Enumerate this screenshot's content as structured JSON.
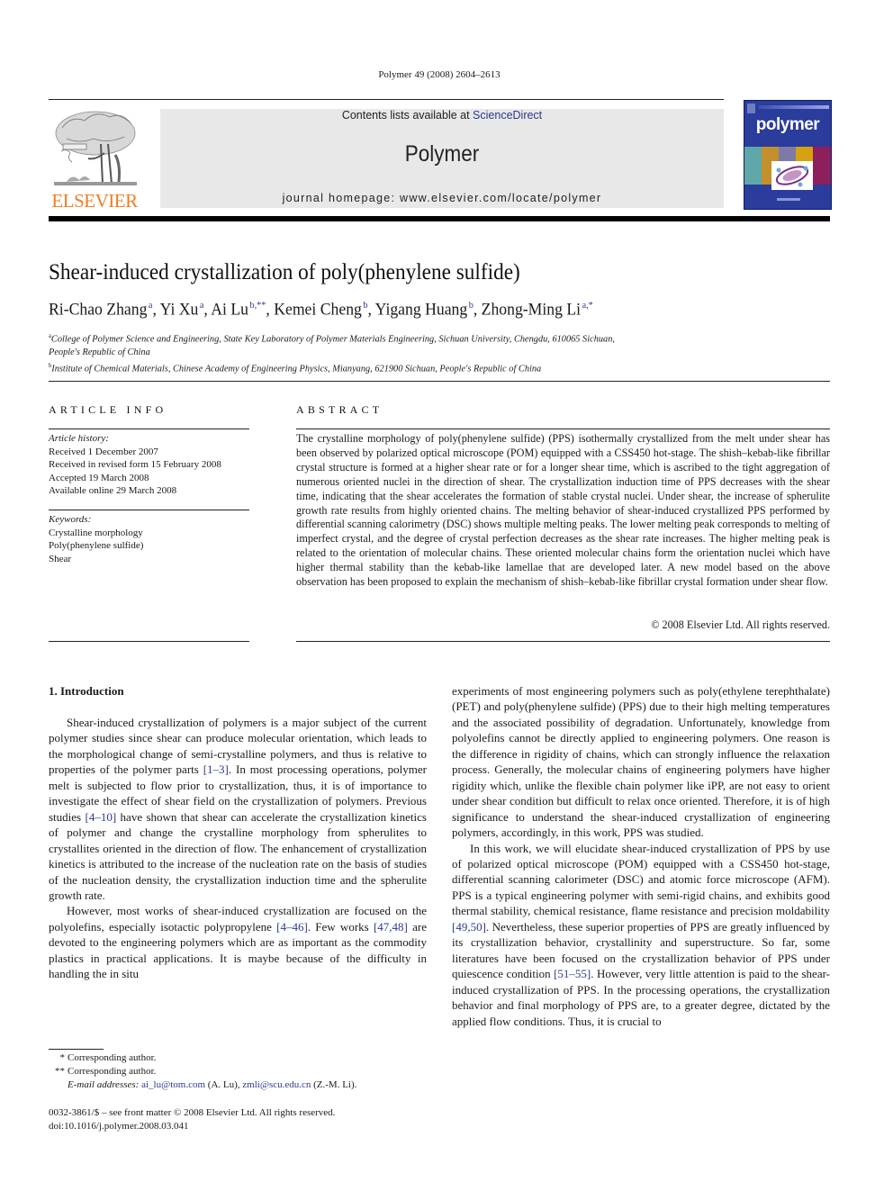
{
  "citation": "Polymer 49 (2008) 2604–2613",
  "header": {
    "publisher_logo_text": "ELSEVIER",
    "contents_prefix": "Contents lists available at ",
    "contents_link": "ScienceDirect",
    "journal_name": "Polymer",
    "homepage": "journal homepage: www.elsevier.com/locate/polymer",
    "cover_title": "polymer",
    "colors": {
      "elsevier_orange": "#f07d22",
      "cover_blue": "#2a3c9c",
      "link_blue": "#2b3a8f"
    }
  },
  "article": {
    "title": "Shear-induced crystallization of poly(phenylene sulfide)",
    "authors": [
      {
        "name": "Ri-Chao Zhang",
        "sup": "a",
        "sep": ", "
      },
      {
        "name": "Yi Xu",
        "sup": "a",
        "sep": ", "
      },
      {
        "name": "Ai Lu",
        "sup": "b,**",
        "sep": ", "
      },
      {
        "name": "Kemei Cheng",
        "sup": "b",
        "sep": ", "
      },
      {
        "name": "Yigang Huang",
        "sup": "b",
        "sep": ", "
      },
      {
        "name": "Zhong-Ming Li",
        "sup": "a,*",
        "sep": ""
      }
    ],
    "affiliations": [
      {
        "mark": "a",
        "text": "College of Polymer Science and Engineering, State Key Laboratory of Polymer Materials Engineering, Sichuan University, Chengdu, 610065 Sichuan, People's Republic of China"
      },
      {
        "mark": "b",
        "text": "Institute of Chemical Materials, Chinese Academy of Engineering Physics, Mianyang, 621900 Sichuan, People's Republic of China"
      }
    ]
  },
  "article_info": {
    "heading": "ARTICLE INFO",
    "history_label": "Article history:",
    "history": [
      "Received 1 December 2007",
      "Received in revised form 15 February 2008",
      "Accepted 19 March 2008",
      "Available online 29 March 2008"
    ],
    "keywords_label": "Keywords:",
    "keywords": [
      "Crystalline morphology",
      "Poly(phenylene sulfide)",
      "Shear"
    ]
  },
  "abstract": {
    "heading": "ABSTRACT",
    "text": "The crystalline morphology of poly(phenylene sulfide) (PPS) isothermally crystallized from the melt under shear has been observed by polarized optical microscope (POM) equipped with a CSS450 hot-stage. The shish–kebab-like fibrillar crystal structure is formed at a higher shear rate or for a longer shear time, which is ascribed to the tight aggregation of numerous oriented nuclei in the direction of shear. The crystallization induction time of PPS decreases with the shear time, indicating that the shear accelerates the formation of stable crystal nuclei. Under shear, the increase of spherulite growth rate results from highly oriented chains. The melting behavior of shear-induced crystallized PPS performed by differential scanning calorimetry (DSC) shows multiple melting peaks. The lower melting peak corresponds to melting of imperfect crystal, and the degree of crystal perfection decreases as the shear rate increases. The higher melting peak is related to the orientation of molecular chains. These oriented molecular chains form the orientation nuclei which have higher thermal stability than the kebab-like lamellae that are developed later. A new model based on the above observation has been proposed to explain the mechanism of shish–kebab-like fibrillar crystal formation under shear flow.",
    "copyright": "© 2008 Elsevier Ltd. All rights reserved."
  },
  "body": {
    "section_heading": "1.  Introduction",
    "left_col": {
      "p1": [
        "Shear-induced crystallization of polymers is a major subject of the current polymer studies since shear can produce molecular orientation, which leads to the morphological change of semi-crystalline polymers, and thus is relative to properties of the polymer parts ",
        "[1–3]",
        ". In most processing operations, polymer melt is subjected to flow prior to crystallization, thus, it is of importance to investigate the effect of shear field on the crystallization of polymers. Previous studies ",
        "[4–10]",
        " have shown that shear can accelerate the crystallization kinetics of polymer and change the crystalline morphology from spherulites to crystallites oriented in the direction of flow. The enhancement of crystallization kinetics is attributed to the increase of the nucleation rate on the basis of studies of the nucleation density, the crystallization induction time and the spherulite growth rate."
      ],
      "p2": [
        "However, most works of shear-induced crystallization are focused on the polyolefins, especially isotactic polypropylene ",
        "[4–46]",
        ". Few works ",
        "[47,48]",
        " are devoted to the engineering polymers which are as important as the commodity plastics in practical applications. It is maybe because of the difficulty in handling the in situ"
      ]
    },
    "right_col": {
      "p1": "experiments of most engineering polymers such as poly(ethylene terephthalate) (PET) and poly(phenylene sulfide) (PPS) due to their high melting temperatures and the associated possibility of degradation. Unfortunately, knowledge from polyolefins cannot be directly applied to engineering polymers. One reason is the difference in rigidity of chains, which can strongly influence the relaxation process. Generally, the molecular chains of engineering polymers have higher rigidity which, unlike the flexible chain polymer like iPP, are not easy to orient under shear condition but difficult to relax once oriented. Therefore, it is of high significance to understand the shear-induced crystallization of engineering polymers, accordingly, in this work, PPS was studied.",
      "p2": [
        "In this work, we will elucidate shear-induced crystallization of PPS by use of polarized optical microscope (POM) equipped with a CSS450 hot-stage, differential scanning calorimeter (DSC) and atomic force microscope (AFM). PPS is a typical engineering polymer with semi-rigid chains, and exhibits good thermal stability, chemical resistance, flame resistance and precision moldability ",
        "[49,50]",
        ". Nevertheless, these superior properties of PPS are greatly influenced by its crystallization behavior, crystallinity and superstructure. So far, some literatures have been focused on the crystallization behavior of PPS under quiescence condition ",
        "[51–55]",
        ". However, very little attention is paid to the shear-induced crystallization of PPS. In the processing operations, the crystallization behavior and final morphology of PPS are, to a greater degree, dictated by the applied flow conditions. Thus, it is crucial to"
      ]
    }
  },
  "footnotes": {
    "items": [
      {
        "mark": "*",
        "text": "Corresponding author."
      },
      {
        "mark": "**",
        "text": "Corresponding author."
      }
    ],
    "email_label": "E-mail addresses: ",
    "emails": [
      {
        "address": "ai_lu@tom.com",
        "who": " (A. Lu), "
      },
      {
        "address": "zmli@scu.edu.cn",
        "who": " (Z.-M. Li)."
      }
    ],
    "front_matter": "0032-3861/$ – see front matter © 2008 Elsevier Ltd. All rights reserved.",
    "doi": "doi:10.1016/j.polymer.2008.03.041"
  }
}
